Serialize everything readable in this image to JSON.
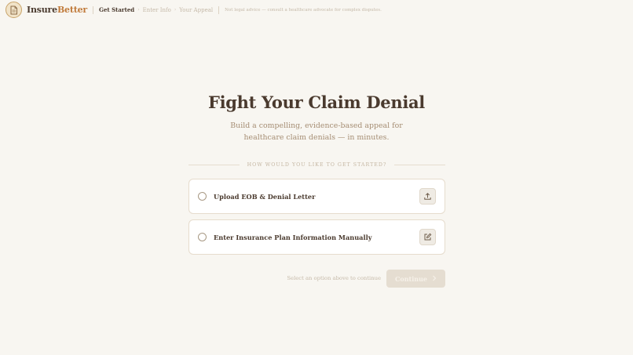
{
  "header": {
    "brand_part1": "Insure",
    "brand_part2": "Better",
    "logo_icon": "document-icon",
    "steps": [
      "Get Started",
      "Enter Info",
      "Your Appeal"
    ],
    "disclaimer": "Not legal advice — consult a healthcare advocate for complex disputes."
  },
  "main": {
    "title": "Fight Your Claim Denial",
    "subtitle": "Build a compelling, evidence-based appeal for healthcare claim denials — in minutes.",
    "prompt": "HOW WOULD YOU LIKE TO GET STARTED?",
    "options": [
      {
        "label": "Upload EOB & Denial Letter",
        "icon": "upload-icon"
      },
      {
        "label": "Enter Insurance Plan Information Manually",
        "icon": "edit-icon"
      }
    ],
    "hint": "Select an option above to continue",
    "continue_label": "Continue"
  },
  "colors": {
    "background": "#f8f6f1",
    "text_dark": "#4a3a2e",
    "brand_accent": "#c07a3a",
    "muted": "#c5b9a8",
    "button_disabled": "#e5ddd1"
  }
}
